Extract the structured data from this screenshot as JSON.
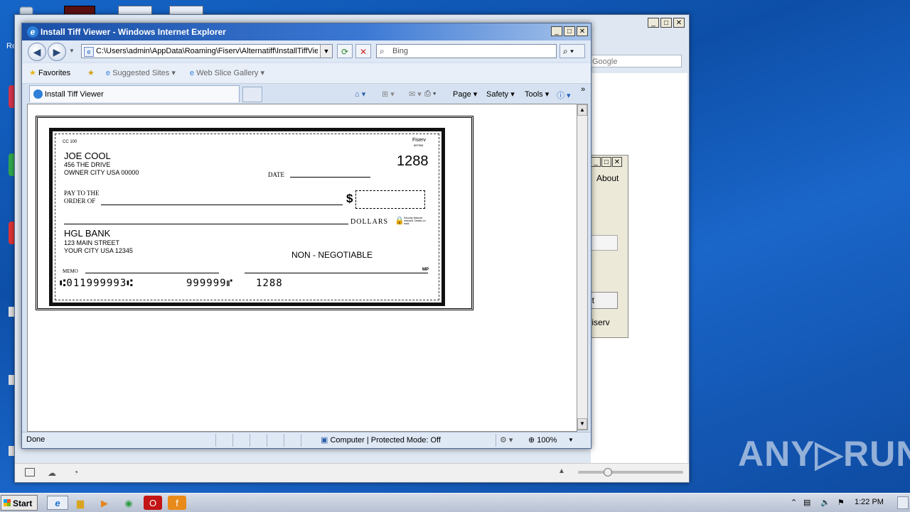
{
  "desktop": {
    "icons": [
      {
        "name": "recycle-bin",
        "label": "Re"
      },
      {
        "name": "app-icon-1",
        "label": ""
      },
      {
        "name": "app-icon-2",
        "label": ""
      }
    ]
  },
  "background_window": {
    "search_placeholder": "Google",
    "dialog_about": "About",
    "dialog_button": "it",
    "dialog_link": "fiserv"
  },
  "ie": {
    "title": "Install Tiff Viewer - Windows Internet Explorer",
    "address": "C:\\Users\\admin\\AppData\\Roaming\\Fiserv\\Alternatiff\\InstallTiffVie",
    "search_placeholder": "Bing",
    "favorites_label": "Favorites",
    "suggested_sites": "Suggested Sites",
    "web_slice_gallery": "Web Slice Gallery",
    "tab_title": "Install Tiff Viewer",
    "tools": {
      "page": "Page",
      "safety": "Safety",
      "tools": "Tools"
    },
    "status": {
      "text": "Done",
      "zone": "Computer | Protected Mode: Off",
      "zoom": "100%"
    }
  },
  "check": {
    "form_code": "CC 100",
    "bank_brand": "Fiserv",
    "brand_sub": "887566",
    "payer_name": "JOE COOL",
    "payer_address1": "456 THE DRIVE",
    "payer_address2": "OWNER CITY USA 00000",
    "check_number": "1288",
    "date_label": "DATE",
    "pay_to_line1": "PAY TO THE",
    "pay_to_line2": "ORDER OF",
    "dollar_sign": "$",
    "dollars_label": "DOLLARS",
    "security_note": "Security features included. Details on back.",
    "bank_name": "HGL BANK",
    "bank_address1": "123 MAIN STREET",
    "bank_address2": "YOUR CITY USA 12345",
    "non_negotiable": "NON - NEGOTIABLE",
    "memo_label": "MEMO",
    "mp_label": "MP",
    "micr_routing": "⑆011999993⑆",
    "micr_account": "999999⑈",
    "micr_check": "1288"
  },
  "watermark": "ANY▷RUN",
  "taskbar": {
    "start_label": "Start",
    "clock": "1:22 PM"
  }
}
